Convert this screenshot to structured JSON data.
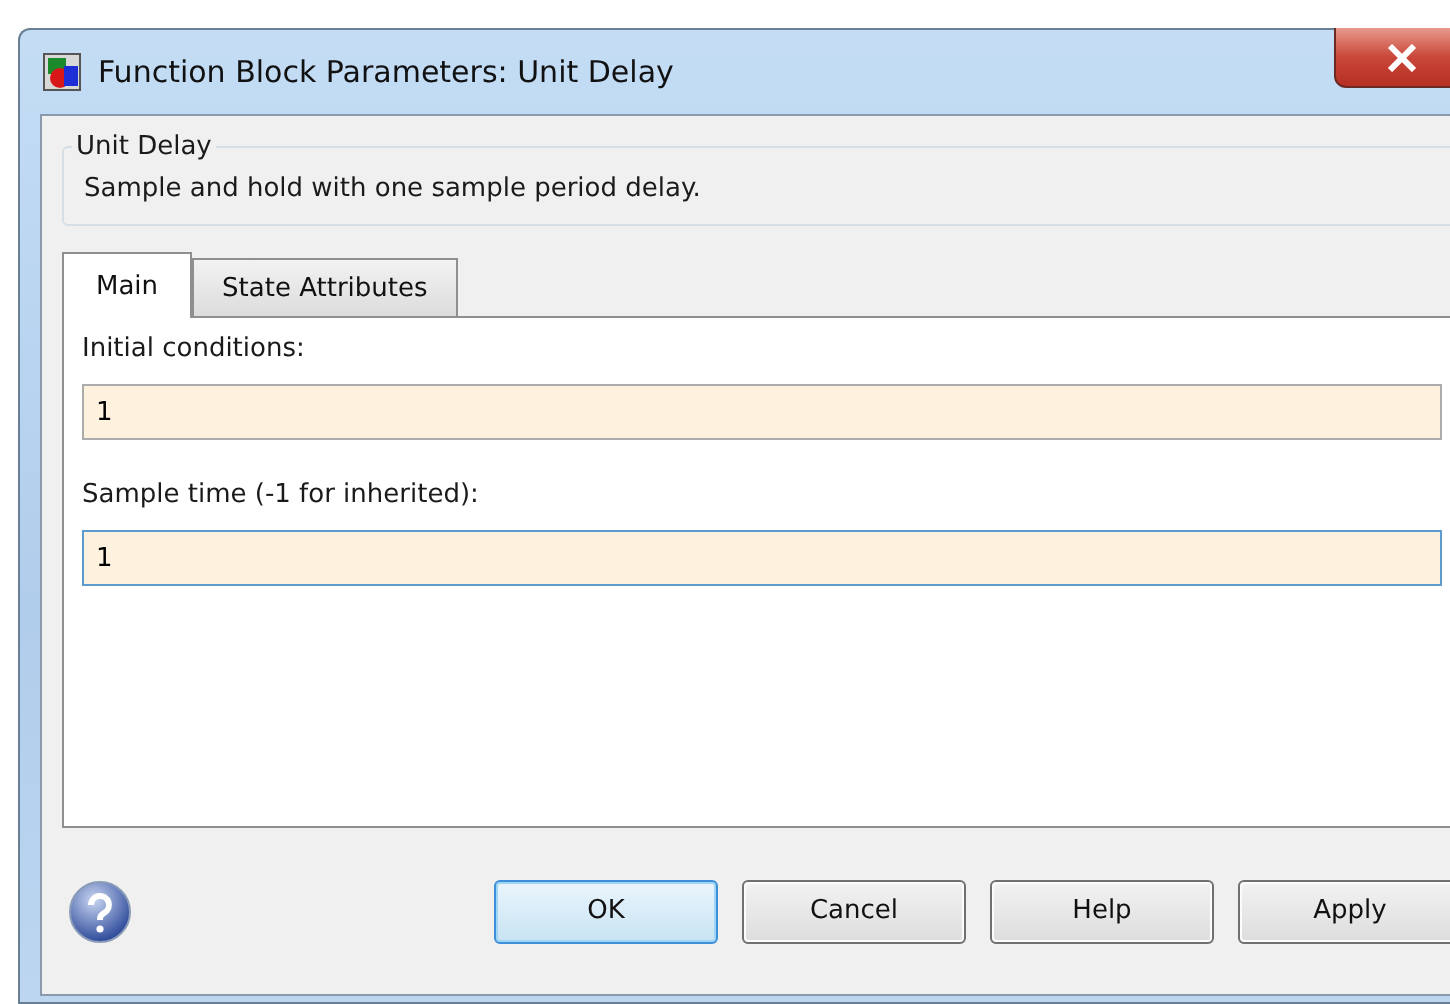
{
  "window": {
    "title": "Function Block Parameters: Unit Delay"
  },
  "group": {
    "title": "Unit Delay",
    "description": "Sample and hold with one sample period delay."
  },
  "tabs": [
    {
      "label": "Main",
      "selected": true
    },
    {
      "label": "State Attributes",
      "selected": false
    }
  ],
  "fields": [
    {
      "label": "Initial conditions:",
      "value": "1",
      "focused": false
    },
    {
      "label": "Sample time (-1 for inherited):",
      "value": "1",
      "focused": true
    }
  ],
  "buttons": [
    {
      "label": "OK",
      "default": true
    },
    {
      "label": "Cancel",
      "default": false
    },
    {
      "label": "Help",
      "default": false
    },
    {
      "label": "Apply",
      "default": false
    }
  ]
}
